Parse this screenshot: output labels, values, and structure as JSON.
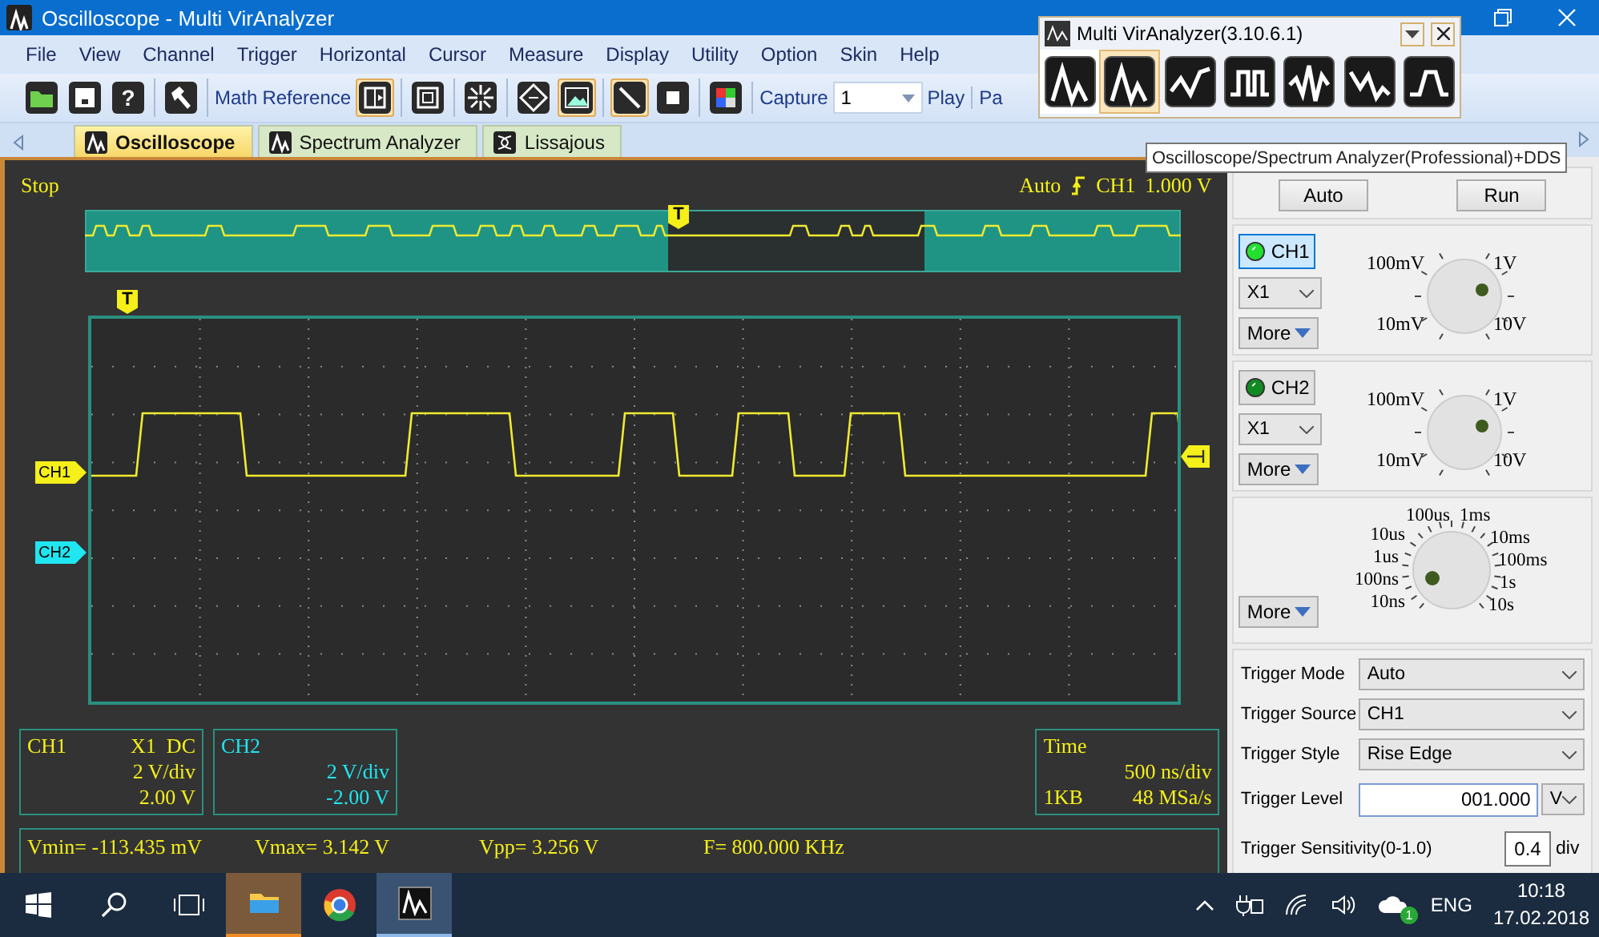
{
  "window": {
    "title": "Oscilloscope - Multi VirAnalyzer"
  },
  "menu": [
    "File",
    "View",
    "Channel",
    "Trigger",
    "Horizontal",
    "Cursor",
    "Measure",
    "Display",
    "Utility",
    "Option",
    "Skin",
    "Help"
  ],
  "toolbar": [
    [
      {
        "kind": "icon",
        "selected": false
      },
      {
        "kind": "icon",
        "selected": false
      },
      {
        "kind": "glyph",
        "text": "?",
        "selected": false
      }
    ],
    [
      {
        "kind": "icon",
        "selected": false
      }
    ],
    [
      {
        "kind": "text",
        "text": "Math"
      },
      {
        "kind": "text",
        "text": "Reference"
      },
      {
        "kind": "icon",
        "selected": true
      }
    ],
    [
      {
        "kind": "icon",
        "selected": false
      }
    ],
    [
      {
        "kind": "icon",
        "selected": false
      }
    ],
    [
      {
        "kind": "icon",
        "selected": false
      },
      {
        "kind": "icon",
        "selected": true
      }
    ],
    [
      {
        "kind": "icon",
        "selected": true
      },
      {
        "kind": "icon",
        "selected": false
      }
    ],
    [
      {
        "kind": "icon",
        "selected": false
      }
    ],
    [
      {
        "kind": "text",
        "text": "Capture"
      },
      {
        "kind": "combo",
        "value": "1"
      },
      {
        "kind": "text",
        "text": "Play"
      }
    ],
    [
      {
        "kind": "text",
        "text": "Pa"
      }
    ]
  ],
  "tabs": [
    {
      "label": "Oscilloscope",
      "selected": true
    },
    {
      "label": "Spectrum Analyzer",
      "selected": false
    },
    {
      "label": "Lissajous",
      "selected": false
    }
  ],
  "scope": {
    "status": "Stop",
    "trigger": {
      "mode": "Auto",
      "source": "CH1",
      "level": "1.000 V"
    },
    "overview_marker": "T",
    "trigger_marker": "T",
    "channel_markers": [
      {
        "label": "CH1",
        "color": "#f5ef1a"
      },
      {
        "label": "CH2",
        "color": "#1fe6f0"
      }
    ],
    "info": [
      {
        "kind": "channel",
        "title": "CH1",
        "coupling": "X1  DC",
        "scale": "2 V/div",
        "offset": "2.00 V",
        "color": "#f5ef1a"
      },
      {
        "kind": "channel",
        "title": "CH2",
        "scale": "2 V/div",
        "offset": "-2.00 V",
        "color": "#1fe6f0"
      },
      {
        "kind": "time",
        "title": "Time",
        "scale": "500 ns/div",
        "memory": "1KB",
        "rate": "48 MSa/s",
        "color": "#f5ef1a"
      }
    ],
    "measurements": [
      "Vmin= -113.435 mV",
      "Vmax= 3.142 V",
      "Vpp= 3.256 V",
      "F= 800.000 KHz"
    ]
  },
  "side": {
    "buttons": [
      "Auto",
      "Run"
    ],
    "channels": [
      {
        "label": "CH1",
        "selected": true,
        "probe": "X1",
        "more": "More",
        "knob_labels": [
          "100mV",
          "1V",
          "10mV",
          "10V"
        ]
      },
      {
        "label": "CH2",
        "selected": false,
        "probe": "X1",
        "more": "More",
        "knob_labels": [
          "100mV",
          "1V",
          "10mV",
          "10V"
        ]
      }
    ],
    "timebase": {
      "more": "More",
      "knob_labels": [
        "100us",
        "1ms",
        "10us",
        "10ms",
        "1us",
        "100ms",
        "100ns",
        "1s",
        "10ns",
        "10s"
      ]
    },
    "trigger": [
      {
        "kind": "select",
        "label": "Trigger Mode",
        "value": "Auto"
      },
      {
        "kind": "select",
        "label": "Trigger Source",
        "value": "CH1"
      },
      {
        "kind": "select",
        "label": "Trigger Style",
        "value": "Rise Edge"
      },
      {
        "kind": "input",
        "label": "Trigger Level",
        "value": "001.000",
        "unit": "V"
      },
      {
        "kind": "small_input",
        "label": "Trigger Sensitivity(0-1.0)",
        "value": "0.4",
        "unit": "div"
      }
    ]
  },
  "floating": {
    "title": "Multi VirAnalyzer(3.10.6.1)",
    "tools": [
      {
        "selected": false
      },
      {
        "selected": true
      },
      {
        "selected": false
      },
      {
        "selected": false
      },
      {
        "selected": false
      },
      {
        "selected": false
      },
      {
        "selected": false
      }
    ]
  },
  "tooltip": "Oscilloscope/Spectrum Analyzer(Professional)+DDS",
  "taskbar": {
    "apps": [
      {
        "selected": false,
        "attention": true
      },
      {
        "selected": false,
        "attention": false
      },
      {
        "selected": true,
        "attention": false
      }
    ],
    "notification_count": "1",
    "language": "ENG",
    "time": "10:18",
    "date": "17.02.2018"
  }
}
